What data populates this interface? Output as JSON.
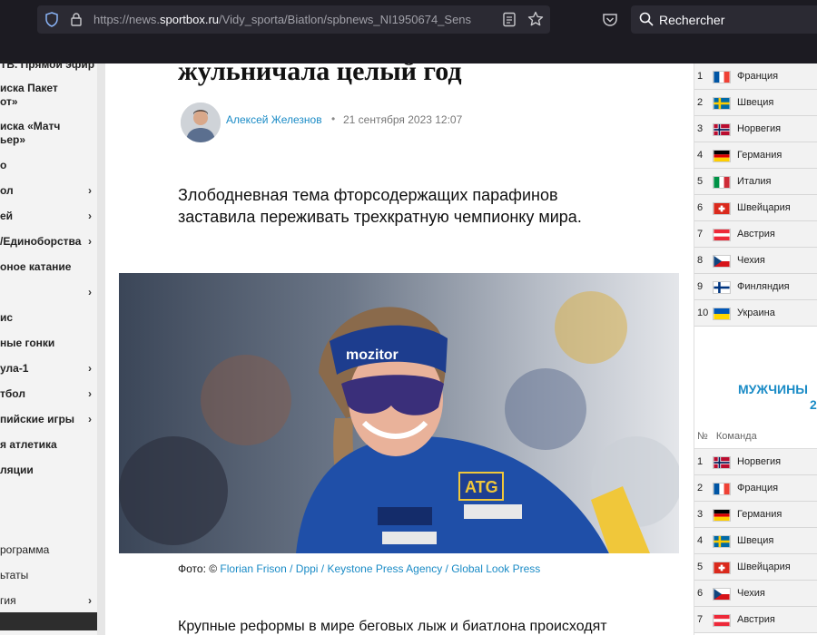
{
  "browser": {
    "url_prefix": "https://news.",
    "url_domain": "sportbox.ru",
    "url_rest": "/Vidy_sporta/Biatlon/spbnews_NI1950674_Sens",
    "search_placeholder": "Rechercher"
  },
  "sidebar": {
    "items": [
      {
        "label": "ТВ. Прямой эфир",
        "chevron": false
      },
      {
        "label": "иска Пакет\nот»",
        "chevron": false
      },
      {
        "label": "иска «Матч\nьер»",
        "chevron": false
      },
      {
        "label": "о",
        "chevron": false
      },
      {
        "label": "ол",
        "chevron": true
      },
      {
        "label": "ей",
        "chevron": true
      },
      {
        "label": "/Единоборства",
        "chevron": true
      },
      {
        "label": "оное катание",
        "chevron": false
      },
      {
        "label": "",
        "chevron": true
      },
      {
        "label": "ис",
        "chevron": false
      },
      {
        "label": "ные гонки",
        "chevron": false
      },
      {
        "label": "ула-1",
        "chevron": true
      },
      {
        "label": "тбол",
        "chevron": true
      },
      {
        "label": "пийские игры",
        "chevron": true
      },
      {
        "label": "я атлетика",
        "chevron": false
      },
      {
        "label": "ляции",
        "chevron": false
      },
      {
        "label": "рограмма",
        "chevron": false
      },
      {
        "label": "ьтаты",
        "chevron": false
      },
      {
        "label": "гия",
        "chevron": true
      }
    ],
    "chevron_glyph": "›"
  },
  "article": {
    "headline": "жульничала целый год",
    "author": "Алексей Железнов",
    "dot": "•",
    "date": "21 сентября 2023 12:07",
    "lead": "Злободневная тема фторсодержащих парафинов заставила переживать трехкратную чемпионку мира.",
    "caption_prefix": "Фото: ©",
    "caption_credit": "Florian Frison / Dppi / Keystone Press Agency / Global Look Press",
    "body_start": "Крупные реформы в мире беговых лыж и биатлона происходят"
  },
  "standings": {
    "women": [
      {
        "num": "1",
        "country": "Франция",
        "flag": "fr"
      },
      {
        "num": "2",
        "country": "Швеция",
        "flag": "se"
      },
      {
        "num": "3",
        "country": "Норвегия",
        "flag": "no"
      },
      {
        "num": "4",
        "country": "Германия",
        "flag": "de"
      },
      {
        "num": "5",
        "country": "Италия",
        "flag": "it"
      },
      {
        "num": "6",
        "country": "Швейцария",
        "flag": "ch"
      },
      {
        "num": "7",
        "country": "Австрия",
        "flag": "at"
      },
      {
        "num": "8",
        "country": "Чехия",
        "flag": "cz"
      },
      {
        "num": "9",
        "country": "Финляндия",
        "flag": "fi"
      },
      {
        "num": "10",
        "country": "Украина",
        "flag": "ua"
      }
    ],
    "men_title": "МУЖЧИНЫ",
    "men_year": "2",
    "col_num": "№",
    "col_team": "Команда",
    "men": [
      {
        "num": "1",
        "country": "Норвегия",
        "flag": "no"
      },
      {
        "num": "2",
        "country": "Франция",
        "flag": "fr"
      },
      {
        "num": "3",
        "country": "Германия",
        "flag": "de"
      },
      {
        "num": "4",
        "country": "Швеция",
        "flag": "se"
      },
      {
        "num": "5",
        "country": "Швейцария",
        "flag": "ch"
      },
      {
        "num": "6",
        "country": "Чехия",
        "flag": "cz"
      },
      {
        "num": "7",
        "country": "Австрия",
        "flag": "at"
      }
    ]
  },
  "colors": {
    "link": "#1a8bc6",
    "toolbar": "#1c1b22",
    "urlbar": "#2b2a33"
  }
}
